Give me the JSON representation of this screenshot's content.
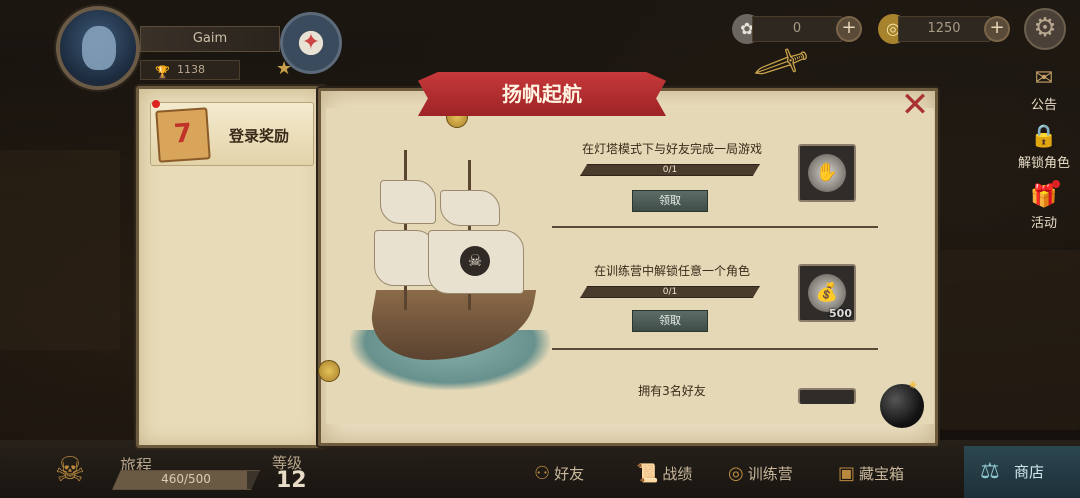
{
  "player": {
    "name": "Gaim",
    "trophies": "1138"
  },
  "currency": {
    "gems": "0",
    "gold": "1250"
  },
  "side_menu": {
    "notice": "公告",
    "unlock_character": "解锁角色",
    "activity": "活动"
  },
  "panel": {
    "title": "扬帆起航",
    "tab_login_reward": "登录奖励",
    "tab_icon_text": "7"
  },
  "quests": [
    {
      "title": "在灯塔模式下与好友完成一局游戏",
      "progress": "0/1",
      "progress_fraction": 0,
      "claim_label": "领取",
      "reward_icon": "lighthouse-token-icon",
      "reward_count": ""
    },
    {
      "title": "在训练营中解锁任意一个角色",
      "progress": "0/1",
      "progress_fraction": 0,
      "claim_label": "领取",
      "reward_icon": "coin-bag-icon",
      "reward_count": "500"
    },
    {
      "title": "拥有3名好友"
    }
  ],
  "bottom_bar": {
    "journey_label": "旅程",
    "journey_progress": "460/500",
    "journey_fraction": 0.92,
    "level_label": "等级",
    "level": "12",
    "friends": "好友",
    "record": "战绩",
    "training_camp": "训练营",
    "treasure_chest": "藏宝箱",
    "shop": "商店"
  },
  "colors": {
    "ribbon": "#b12d2f",
    "parchment": "#ece1c3",
    "claim_button": "#4e5d57",
    "notification_dot": "#dd2222"
  }
}
